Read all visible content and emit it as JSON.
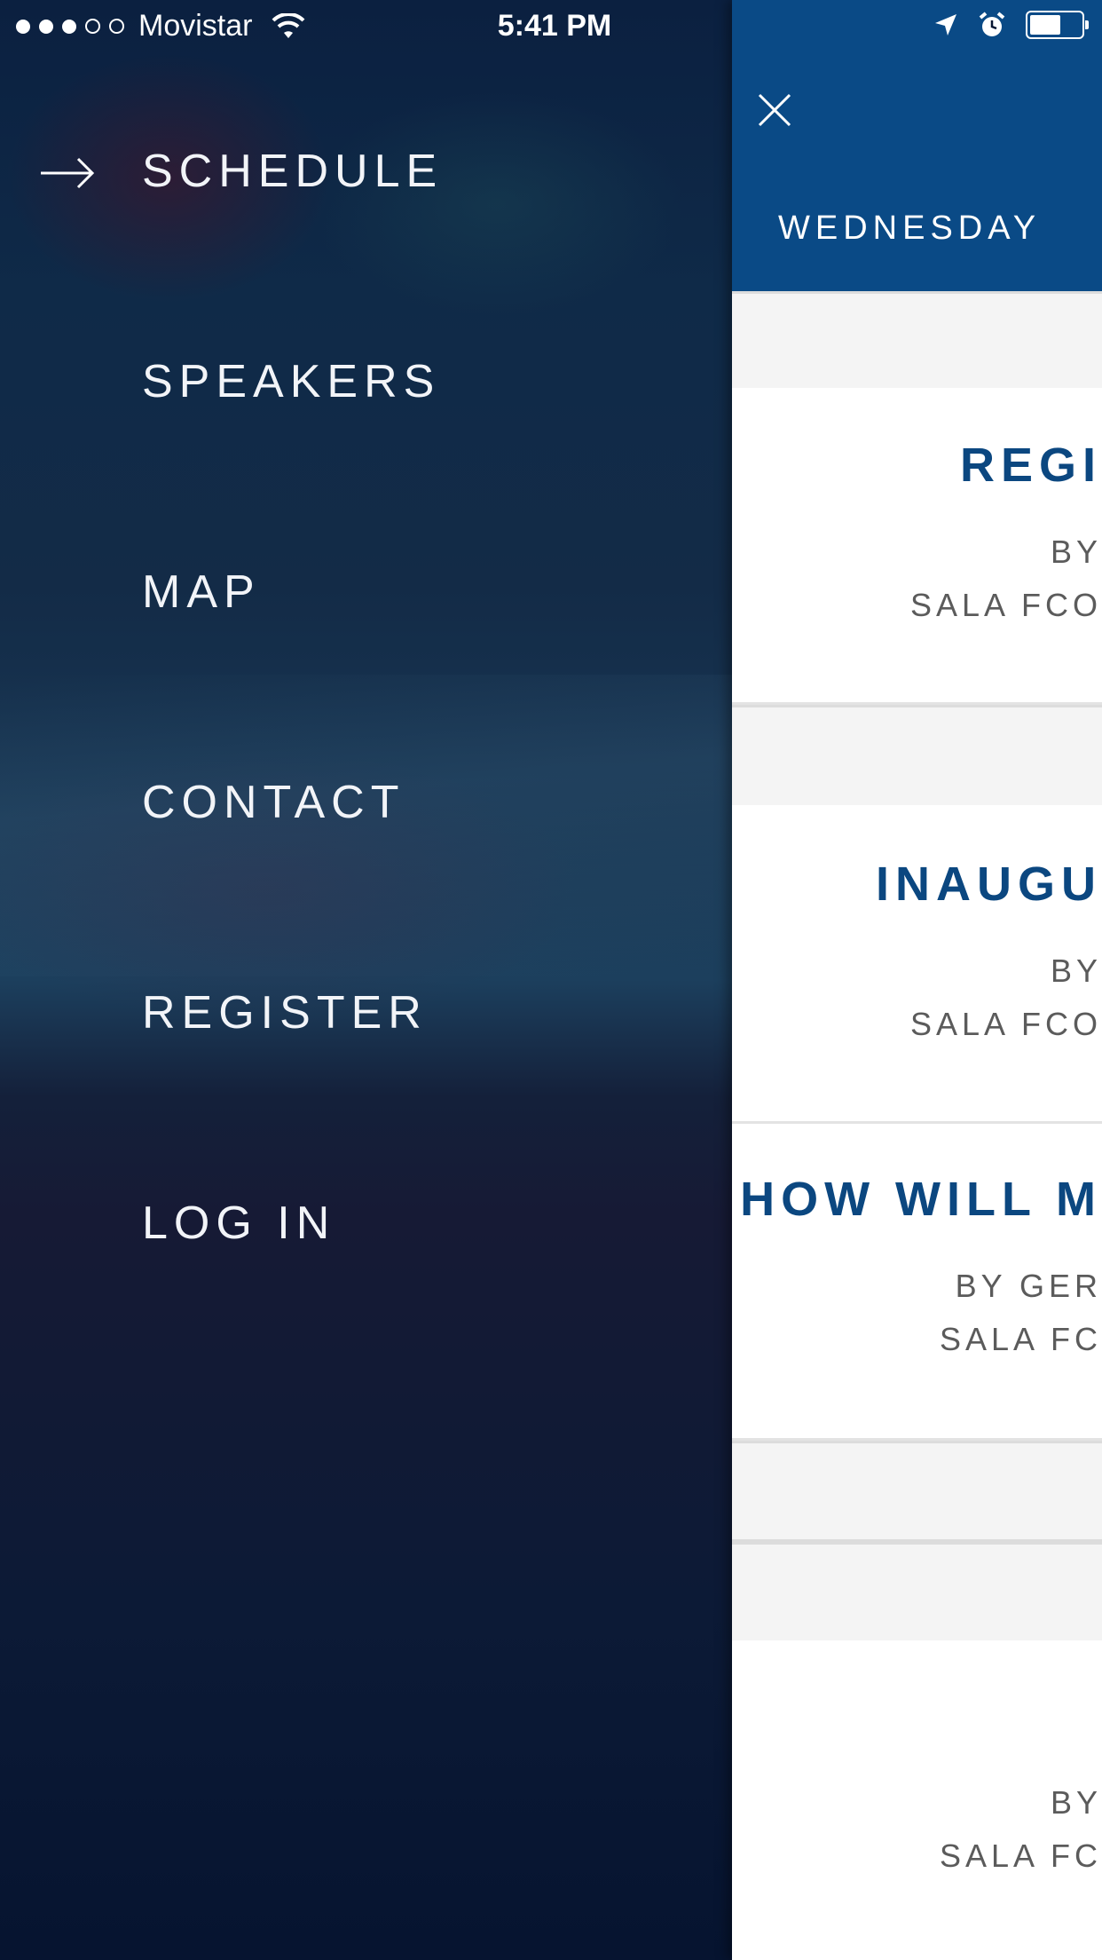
{
  "status_bar": {
    "carrier": "Movistar",
    "time": "5:41 PM",
    "signal_bars_filled": 3,
    "signal_bars_total": 5,
    "battery_level": 0.55
  },
  "menu": {
    "items": [
      {
        "label": "SCHEDULE",
        "active": true
      },
      {
        "label": "SPEAKERS",
        "active": false
      },
      {
        "label": "MAP",
        "active": false
      },
      {
        "label": "CONTACT",
        "active": false
      },
      {
        "label": "REGISTER",
        "active": false
      },
      {
        "label": "LOG IN",
        "active": false
      }
    ]
  },
  "panel": {
    "day_tab": "WEDNESDAY",
    "sessions": [
      {
        "title": "REGI",
        "by": "BY",
        "room": "SALA FCO"
      },
      {
        "title": "INAUGU",
        "by": "BY",
        "room": "SALA FCO"
      },
      {
        "title": "HOW WILL M",
        "by": "BY GER",
        "room": "SALA FC"
      },
      {
        "title": "",
        "by": "BY",
        "room": "SALA FC"
      }
    ]
  },
  "colors": {
    "header_blue": "#0a4a86",
    "title_blue": "#0b4780",
    "text_gray": "#5b5b5b"
  }
}
